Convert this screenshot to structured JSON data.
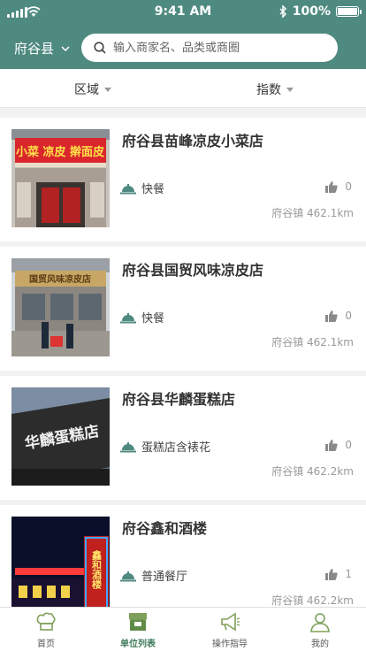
{
  "status_bar": {
    "time": "9:41 AM",
    "battery": "100%"
  },
  "header": {
    "city": "府谷县",
    "search_placeholder": "输入商家名、品类或商圈"
  },
  "filters": [
    {
      "label": "区域"
    },
    {
      "label": "指数"
    }
  ],
  "shops": [
    {
      "name": "府谷县苗峰凉皮小菜店",
      "category": "快餐",
      "likes": "0",
      "location": "府谷镇 462.1km",
      "sign_text": "小菜 凉皮 擀面皮"
    },
    {
      "name": "府谷县国贸风味凉皮店",
      "category": "快餐",
      "likes": "0",
      "location": "府谷镇 462.1km",
      "sign_text": "国贸风味凉皮店"
    },
    {
      "name": "府谷县华麟蛋糕店",
      "category": "蛋糕店含裱花",
      "likes": "0",
      "location": "府谷镇 462.2km",
      "sign_text": "华麟蛋糕店"
    },
    {
      "name": "府谷鑫和酒楼",
      "category": "普通餐厅",
      "likes": "1",
      "location": "府谷镇 462.2km",
      "sign_text": "鑫和酒楼"
    }
  ],
  "tabbar": [
    {
      "label": "首页",
      "icon": "chef-hat-icon"
    },
    {
      "label": "单位列表",
      "icon": "storefront-icon",
      "active": true
    },
    {
      "label": "操作指导",
      "icon": "megaphone-icon"
    },
    {
      "label": "我的",
      "icon": "user-icon"
    }
  ],
  "colors": {
    "header": "#4f8a80",
    "accent": "#3e7a5a"
  }
}
